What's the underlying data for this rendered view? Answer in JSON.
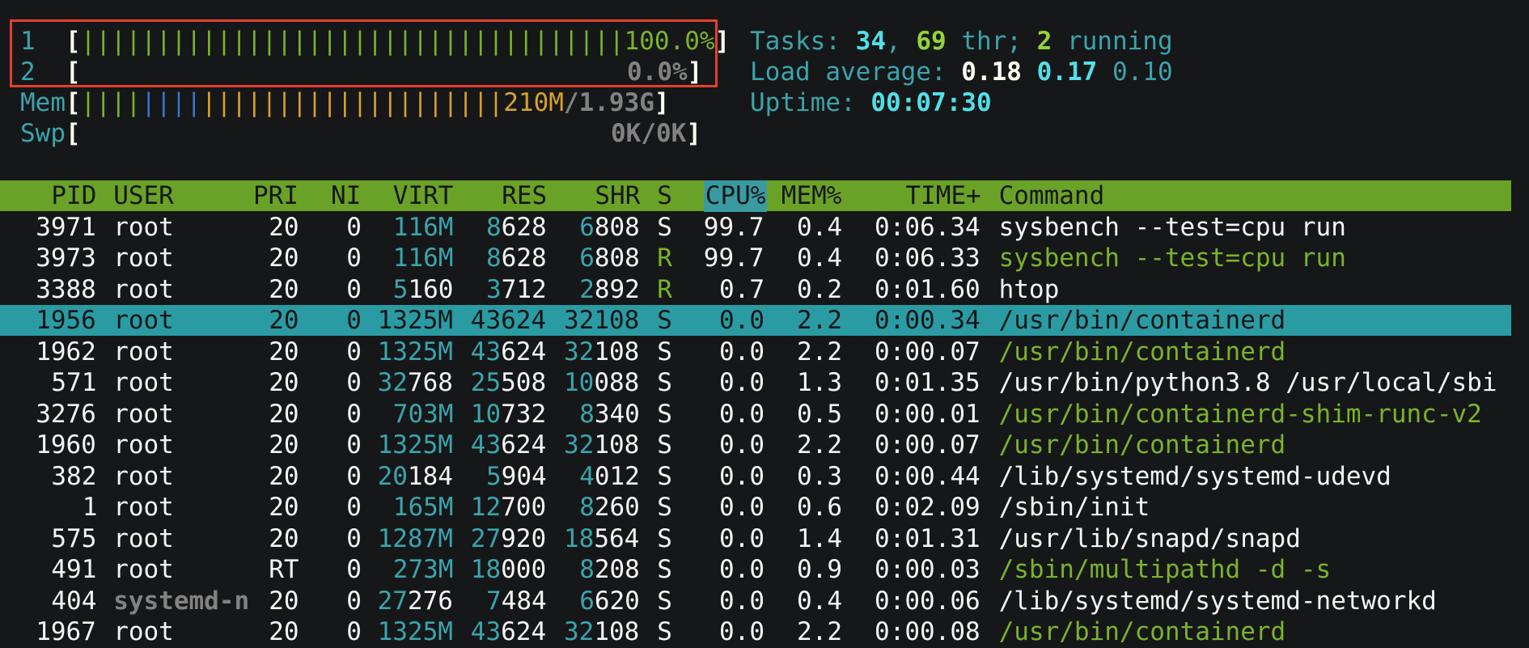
{
  "meters": {
    "cpu1": {
      "label": "1",
      "bar": "||||||||||||||||||||||||||||||||||||",
      "value": "100.0%"
    },
    "cpu2": {
      "label": "2",
      "value": "0.0%"
    },
    "mem": {
      "label": "Mem",
      "bar_blue": "||||",
      "bar_green": "||||",
      "bar_amber": "||||||||||||||||||||",
      "used": "210M",
      "total": "/1.93G"
    },
    "swp": {
      "label": "Swp",
      "value": "0K/0K"
    }
  },
  "summary": {
    "tasks_label": "Tasks: ",
    "tasks": "34",
    "thr": "69",
    "thr_label": " thr; ",
    "running": "2",
    "running_label": " running",
    "load_label": "Load average: ",
    "load1": "0.18",
    "load5": "0.17",
    "load15": "0.10",
    "uptime_label": "Uptime: ",
    "uptime": "00:07:30"
  },
  "columns": [
    "PID",
    "USER",
    "PRI",
    "NI",
    "VIRT",
    "RES",
    "SHR",
    "S",
    "CPU%",
    "MEM%",
    "TIME+",
    "Command"
  ],
  "processes": [
    {
      "pid": "3971",
      "user": "root",
      "pri": "20",
      "ni": "0",
      "virt": "116M",
      "res": "8628",
      "shr": "6808",
      "s": "S",
      "cpu": "99.7",
      "mem": "0.4",
      "time": "0:06.34",
      "cmd": "sysbench --test=cpu run",
      "thread": false
    },
    {
      "pid": "3973",
      "user": "root",
      "pri": "20",
      "ni": "0",
      "virt": "116M",
      "res": "8628",
      "shr": "6808",
      "s": "R",
      "cpu": "99.7",
      "mem": "0.4",
      "time": "0:06.33",
      "cmd": "sysbench --test=cpu run",
      "thread": true
    },
    {
      "pid": "3388",
      "user": "root",
      "pri": "20",
      "ni": "0",
      "virt": "5160",
      "res": "3712",
      "shr": "2892",
      "s": "R",
      "cpu": "0.7",
      "mem": "0.2",
      "time": "0:01.60",
      "cmd": "htop",
      "thread": false
    },
    {
      "pid": "1956",
      "user": "root",
      "pri": "20",
      "ni": "0",
      "virt": "1325M",
      "res": "43624",
      "shr": "32108",
      "s": "S",
      "cpu": "0.0",
      "mem": "2.2",
      "time": "0:00.34",
      "cmd": "/usr/bin/containerd",
      "thread": false,
      "selected": true
    },
    {
      "pid": "1962",
      "user": "root",
      "pri": "20",
      "ni": "0",
      "virt": "1325M",
      "res": "43624",
      "shr": "32108",
      "s": "S",
      "cpu": "0.0",
      "mem": "2.2",
      "time": "0:00.07",
      "cmd": "/usr/bin/containerd",
      "thread": true
    },
    {
      "pid": "571",
      "user": "root",
      "pri": "20",
      "ni": "0",
      "virt": "32768",
      "res": "25508",
      "shr": "10088",
      "s": "S",
      "cpu": "0.0",
      "mem": "1.3",
      "time": "0:01.35",
      "cmd": "/usr/bin/python3.8 /usr/local/sbi",
      "thread": false
    },
    {
      "pid": "3276",
      "user": "root",
      "pri": "20",
      "ni": "0",
      "virt": "703M",
      "res": "10732",
      "shr": "8340",
      "s": "S",
      "cpu": "0.0",
      "mem": "0.5",
      "time": "0:00.01",
      "cmd": "/usr/bin/containerd-shim-runc-v2",
      "thread": true
    },
    {
      "pid": "1960",
      "user": "root",
      "pri": "20",
      "ni": "0",
      "virt": "1325M",
      "res": "43624",
      "shr": "32108",
      "s": "S",
      "cpu": "0.0",
      "mem": "2.2",
      "time": "0:00.07",
      "cmd": "/usr/bin/containerd",
      "thread": true
    },
    {
      "pid": "382",
      "user": "root",
      "pri": "20",
      "ni": "0",
      "virt": "20184",
      "res": "5904",
      "shr": "4012",
      "s": "S",
      "cpu": "0.0",
      "mem": "0.3",
      "time": "0:00.44",
      "cmd": "/lib/systemd/systemd-udevd",
      "thread": false
    },
    {
      "pid": "1",
      "user": "root",
      "pri": "20",
      "ni": "0",
      "virt": "165M",
      "res": "12700",
      "shr": "8260",
      "s": "S",
      "cpu": "0.0",
      "mem": "0.6",
      "time": "0:02.09",
      "cmd": "/sbin/init",
      "thread": false
    },
    {
      "pid": "575",
      "user": "root",
      "pri": "20",
      "ni": "0",
      "virt": "1287M",
      "res": "27920",
      "shr": "18564",
      "s": "S",
      "cpu": "0.0",
      "mem": "1.4",
      "time": "0:01.31",
      "cmd": "/usr/lib/snapd/snapd",
      "thread": false
    },
    {
      "pid": "491",
      "user": "root",
      "pri": "RT",
      "ni": "0",
      "virt": "273M",
      "res": "18000",
      "shr": "8208",
      "s": "S",
      "cpu": "0.0",
      "mem": "0.9",
      "time": "0:00.03",
      "cmd": "/sbin/multipathd -d -s",
      "thread": true
    },
    {
      "pid": "404",
      "user": "systemd-n",
      "pri": "20",
      "ni": "0",
      "virt": "27276",
      "res": "7484",
      "shr": "6620",
      "s": "S",
      "cpu": "0.0",
      "mem": "0.4",
      "time": "0:00.06",
      "cmd": "/lib/systemd/systemd-networkd",
      "thread": false,
      "dim_user": true
    },
    {
      "pid": "1967",
      "user": "root",
      "pri": "20",
      "ni": "0",
      "virt": "1325M",
      "res": "43624",
      "shr": "32108",
      "s": "S",
      "cpu": "0.0",
      "mem": "2.2",
      "time": "0:00.08",
      "cmd": "/usr/bin/containerd",
      "thread": true
    }
  ]
}
